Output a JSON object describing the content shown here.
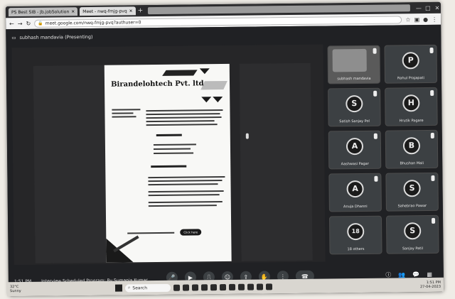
{
  "browser": {
    "tabs": [
      {
        "label": "PS Best SIB - Jb.jobSolution",
        "active": false
      },
      {
        "label": "Meet - nwq-fmjg-pvq",
        "active": true
      }
    ],
    "new_tab": "+",
    "window_controls": [
      "—",
      "□",
      "✕"
    ],
    "url": "meet.google.com/nwq-fmjg-pvq?authuser=0"
  },
  "meeting": {
    "title": "subhash mandavia (Presenting)",
    "time": "1:51 PM",
    "meeting_name": "Interview Scheduled Program: By Sumanja Kumar",
    "presentation": {
      "company": "Birandelohtech Pvt. ltd",
      "cta": "Click here"
    },
    "participants": [
      {
        "name": "subhash mandavia",
        "initial": "",
        "photo": true
      },
      {
        "name": "Rahul Prajapati",
        "initial": "P"
      },
      {
        "name": "Satish Sanjay Pol",
        "initial": "S"
      },
      {
        "name": "Hrutik Pagare",
        "initial": "H"
      },
      {
        "name": "Aashwasi Pagar",
        "initial": "A"
      },
      {
        "name": "Bhushan Mali",
        "initial": "B"
      },
      {
        "name": "Anuja Dhanni",
        "initial": "A"
      },
      {
        "name": "Sahebrao Pawar",
        "initial": "S"
      },
      {
        "name": "18 others",
        "initial": "18"
      },
      {
        "name": "Sanjay Patil",
        "initial": "S"
      }
    ],
    "controls": [
      "mic-icon",
      "camera-icon",
      "captions-icon",
      "emoji-icon",
      "present-icon",
      "hand-icon",
      "more-icon",
      "hangup-icon"
    ],
    "right_controls": [
      "info-icon",
      "people-icon",
      "chat-icon",
      "activities-icon"
    ]
  },
  "taskbar": {
    "weather_temp": "32°C",
    "weather_desc": "Sunny",
    "search_label": "Search",
    "time": "1:51 PM",
    "date": "27-04-2023"
  }
}
